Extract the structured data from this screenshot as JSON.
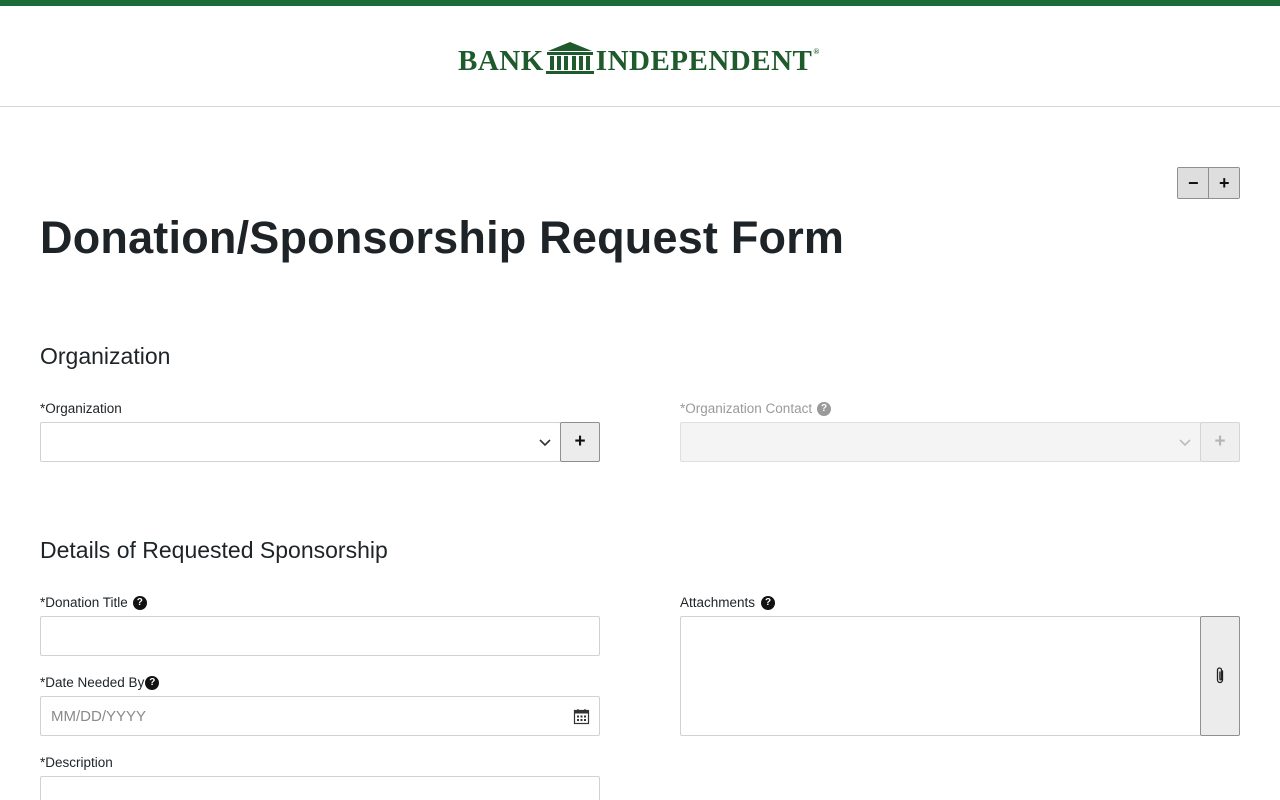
{
  "brand": {
    "logo_left": "BANK",
    "logo_right": "INDEPENDENT",
    "logo_mark": "®",
    "color": "#1e5a2c",
    "stripe_color": "#1e6b3a"
  },
  "zoom": {
    "decrease_label": "−",
    "increase_label": "+"
  },
  "page": {
    "title": "Donation/Sponsorship Request Form"
  },
  "organization_section": {
    "title": "Organization",
    "organization": {
      "label": "*Organization",
      "value": "",
      "add_label": "+",
      "icon": "chevron-down-icon"
    },
    "organization_contact": {
      "label": "*Organization Contact",
      "value": "",
      "add_label": "+",
      "help": "?",
      "disabled": true
    }
  },
  "details_section": {
    "title": "Details of Requested Sponsorship",
    "donation_title": {
      "label": "*Donation Title",
      "help": "?",
      "value": ""
    },
    "date_needed_by": {
      "label": "*Date Needed By",
      "help": "?",
      "placeholder": "MM/DD/YYYY",
      "icon": "calendar-icon"
    },
    "description": {
      "label": "*Description",
      "value": ""
    },
    "attachments": {
      "label": "Attachments",
      "help": "?",
      "icon": "paperclip-icon"
    }
  }
}
